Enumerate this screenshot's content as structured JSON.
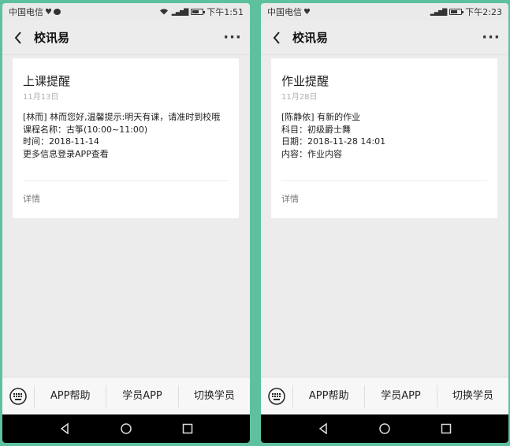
{
  "screens": [
    {
      "status": {
        "carrier": "中国电信",
        "time": "下午1:51"
      },
      "nav": {
        "title": "校讯易"
      },
      "card": {
        "title": "上课提醒",
        "date": "11月13日",
        "lines": [
          "[林而] 林而您好,温馨提示:明天有课，请准时到校哦",
          "课程名称：古筝(10:00~11:00)",
          "时间：2018-11-14",
          "更多信息登录APP查看"
        ],
        "detail": "详情"
      },
      "menu": [
        "APP帮助",
        "学员APP",
        "切换学员"
      ]
    },
    {
      "status": {
        "carrier": "中国电信",
        "time": "下午2:23"
      },
      "nav": {
        "title": "校讯易"
      },
      "card": {
        "title": "作业提醒",
        "date": "11月28日",
        "lines": [
          "[陈静依] 有新的作业",
          "科目：初级爵士舞",
          "日期：2018-11-28 14:01",
          "内容：作业内容"
        ],
        "detail": "详情"
      },
      "menu": [
        "APP帮助",
        "学员APP",
        "切换学员"
      ]
    }
  ]
}
